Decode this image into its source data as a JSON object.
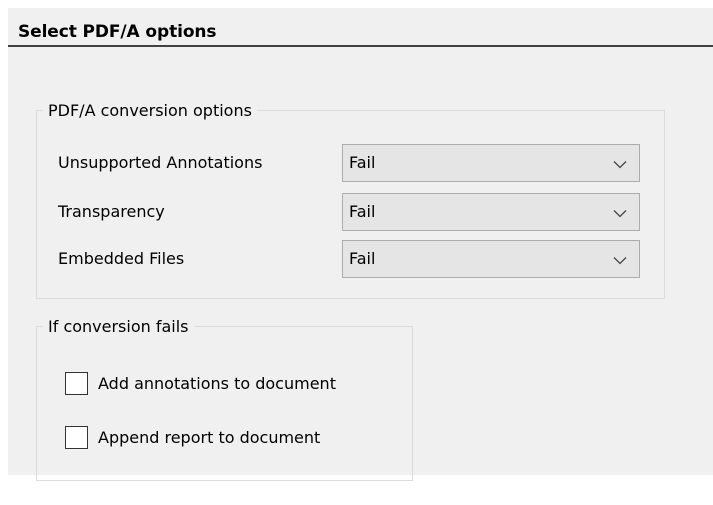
{
  "header": {
    "title": "Select PDF/A options"
  },
  "conversion_options": {
    "legend": "PDF/A conversion options",
    "rows": [
      {
        "label": "Unsupported Annotations",
        "value": "Fail"
      },
      {
        "label": "Transparency",
        "value": "Fail"
      },
      {
        "label": "Embedded Files",
        "value": "Fail"
      }
    ]
  },
  "on_failure": {
    "legend": "If conversion fails",
    "options": [
      {
        "label": "Add annotations to document",
        "checked": false
      },
      {
        "label": "Append report to document",
        "checked": false
      }
    ]
  },
  "icons": {
    "dropdown": "chevron-down-icon",
    "checkbox": "unchecked-checkbox"
  },
  "colors": {
    "panel_background": "#f0f0f0",
    "dropdown_background": "#e5e5e5",
    "dropdown_border": "#adadad",
    "title_rule": "#404040"
  }
}
